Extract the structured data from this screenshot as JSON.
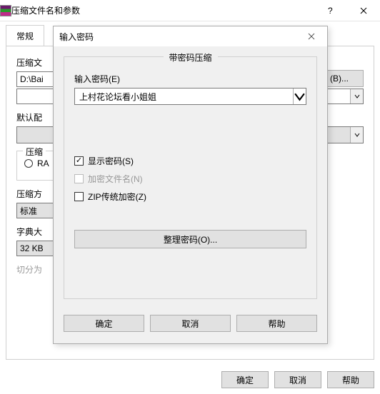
{
  "main": {
    "title": "压缩文件名和参数",
    "tab_general": "常规",
    "archive_name_label": "压缩文",
    "archive_name_value": "D:\\Bai",
    "browse_button": "(B)...",
    "default_profile_label": "默认配",
    "format_legend": "压缩",
    "format_rar": "RA",
    "method_label": "压缩方",
    "method_value": "标准",
    "dict_label": "字典大",
    "dict_value": "32 KB",
    "split_label": "切分为",
    "ok": "确定",
    "cancel": "取消",
    "help": "帮助"
  },
  "modal": {
    "title": "输入密码",
    "group_legend": "带密码压缩",
    "pw_label": "输入密码(E)",
    "pw_value": "上村花论坛看小姐姐",
    "show_pw": "显示密码(S)",
    "encrypt_names": "加密文件名(N)",
    "zip_legacy": "ZIP传统加密(Z)",
    "organize": "整理密码(O)...",
    "ok": "确定",
    "cancel": "取消",
    "help": "帮助",
    "show_pw_checked": true,
    "encrypt_names_checked": false,
    "zip_legacy_checked": false
  }
}
